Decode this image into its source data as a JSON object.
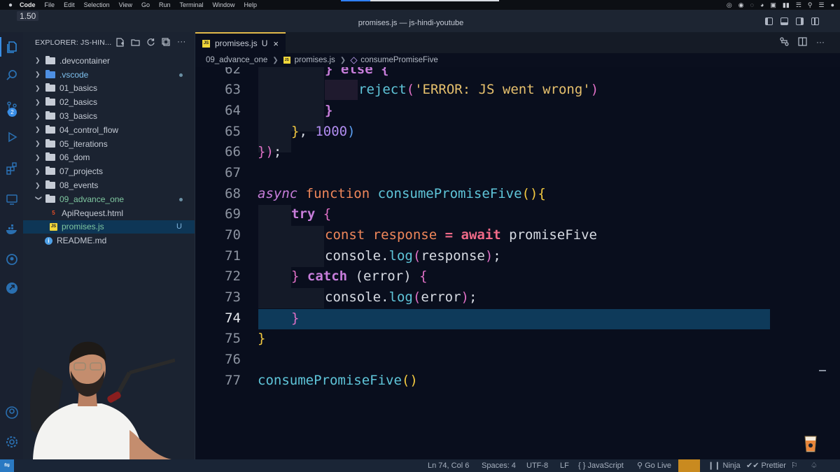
{
  "menubar": {
    "items": [
      "Code",
      "File",
      "Edit",
      "Selection",
      "View",
      "Go",
      "Run",
      "Terminal",
      "Window",
      "Help"
    ]
  },
  "titlebar": {
    "title": "promises.js — js-hindi-youtube",
    "zoom": "1.50"
  },
  "activity_bar": {
    "items": [
      "explorer",
      "search",
      "source-control",
      "run-debug",
      "extensions",
      "remote-explorer",
      "docker",
      "github",
      "live-share",
      "accounts",
      "settings"
    ],
    "source_control_badge": "2"
  },
  "sidebar": {
    "header": "EXPLORER: JS-HIN...",
    "tree": [
      {
        "label": ".devcontainer",
        "type": "folder",
        "expanded": false
      },
      {
        "label": ".vscode",
        "type": "folder-blue",
        "expanded": false,
        "dot": true
      },
      {
        "label": "01_basics",
        "type": "folder",
        "expanded": false
      },
      {
        "label": "02_basics",
        "type": "folder",
        "expanded": false
      },
      {
        "label": "03_basics",
        "type": "folder",
        "expanded": false
      },
      {
        "label": "04_control_flow",
        "type": "folder",
        "expanded": false
      },
      {
        "label": "05_iterations",
        "type": "folder",
        "expanded": false
      },
      {
        "label": "06_dom",
        "type": "folder",
        "expanded": false
      },
      {
        "label": "07_projects",
        "type": "folder",
        "expanded": false
      },
      {
        "label": "08_events",
        "type": "folder",
        "expanded": false
      },
      {
        "label": "09_advance_one",
        "type": "folder-open",
        "expanded": true,
        "dot": true
      },
      {
        "label": "ApiRequest.html",
        "type": "html"
      },
      {
        "label": "promises.js",
        "type": "js",
        "selected": true,
        "status": "U"
      },
      {
        "label": "README.md",
        "type": "info"
      }
    ]
  },
  "editor": {
    "tab": {
      "label": "promises.js",
      "status": "U",
      "close": "×"
    },
    "breadcrumb": [
      "09_advance_one",
      "promises.js",
      "consumePromiseFive"
    ],
    "line_numbers": [
      "62",
      "63",
      "64",
      "65",
      "66",
      "67",
      "68",
      "69",
      "70",
      "71",
      "72",
      "73",
      "74",
      "75",
      "76",
      "77"
    ],
    "active_line": "74",
    "code": {
      "l62a": "} else {",
      "l63_fn": "reject",
      "l63_str": "'ERROR: JS went wrong'",
      "l64": "}",
      "l65_num": "1000",
      "l68_async": "async",
      "l68_fn": "function",
      "l68_name": "consumePromiseFive",
      "l69_try": "try",
      "l70_const": "const",
      "l70_var": "response",
      "l70_await": "await",
      "l70_val": "promiseFive",
      "l71_obj": "console",
      "l71_fn": "log",
      "l71_arg": "response",
      "l72_catch": "catch",
      "l72_arg": "error",
      "l73_obj": "console",
      "l73_fn": "log",
      "l73_arg": "error",
      "l77_call": "consumePromiseFive"
    }
  },
  "statusbar": {
    "position": "Ln 74, Col 6",
    "spaces": "Spaces: 4",
    "encoding": "UTF-8",
    "eol": "LF",
    "language": "{ } JavaScript",
    "golive": "Go Live",
    "ninja": "Ninja",
    "prettier": "Prettier"
  }
}
